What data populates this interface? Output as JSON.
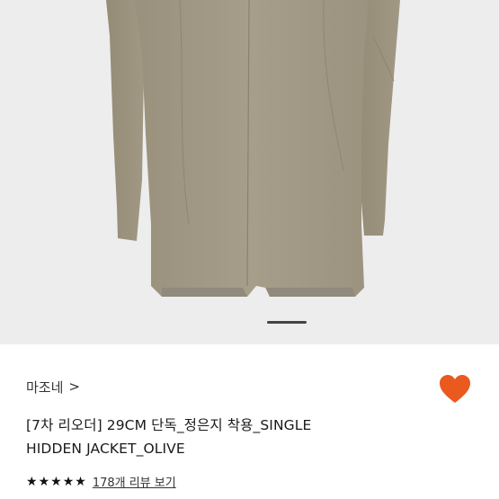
{
  "product": {
    "image_alt": "olive jacket back view",
    "carousel_index": 1
  },
  "brand": {
    "name": "마조네",
    "chevron": ">"
  },
  "wishlist": {
    "icon": "heart-icon",
    "color": "#ea5a1f"
  },
  "title": {
    "line1": "[7차 리오더] 29CM 단독_정은지 착용_SINGLE",
    "line2": "HIDDEN JACKET_OLIVE"
  },
  "rating": {
    "stars": 5,
    "review_text": "178개 리뷰 보기"
  },
  "colors": {
    "accent": "#ea5a1f",
    "jacket": "#a39a86",
    "background": "#ededed"
  }
}
